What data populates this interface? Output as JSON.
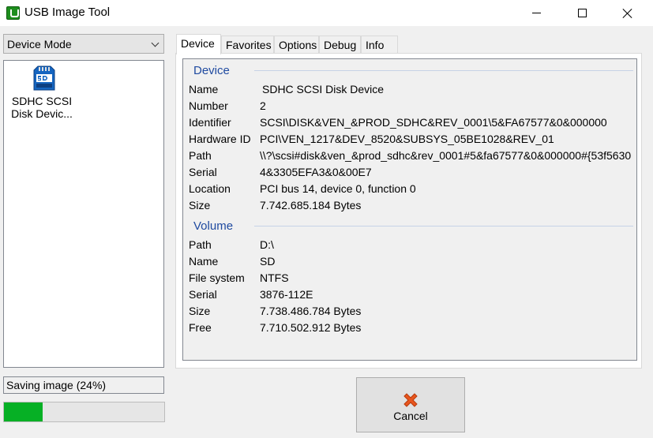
{
  "window": {
    "title": "USB Image Tool"
  },
  "sidebar": {
    "mode_selected": "Device Mode",
    "devices": [
      {
        "label_line1": "SDHC SCSI",
        "label_line2": "Disk Devic..."
      }
    ],
    "status_text": "Saving image (24%)",
    "progress_percent": 24
  },
  "tabs": [
    {
      "label": "Device",
      "active": true
    },
    {
      "label": "Favorites",
      "active": false
    },
    {
      "label": "Options",
      "active": false
    },
    {
      "label": "Debug",
      "active": false
    },
    {
      "label": "Info",
      "active": false
    }
  ],
  "device_section": {
    "title": "Device",
    "rows": [
      {
        "key": "Name",
        "value": "SDHC SCSI Disk Device"
      },
      {
        "key": "Number",
        "value": "2"
      },
      {
        "key": "Identifier",
        "value": "SCSI\\DISK&VEN_&PROD_SDHC&REV_0001\\5&FA67577&0&000000"
      },
      {
        "key": "Hardware ID",
        "value": "PCI\\VEN_1217&DEV_8520&SUBSYS_05BE1028&REV_01"
      },
      {
        "key": "Path",
        "value": "\\\\?\\scsi#disk&ven_&prod_sdhc&rev_0001#5&fa67577&0&000000#{53f5630"
      },
      {
        "key": "Serial",
        "value": "4&3305EFA3&0&00E7"
      },
      {
        "key": "Location",
        "value": "PCI bus 14, device 0, function 0"
      },
      {
        "key": "Size",
        "value": "7.742.685.184 Bytes"
      }
    ]
  },
  "volume_section": {
    "title": "Volume",
    "rows": [
      {
        "key": "Path",
        "value": "D:\\"
      },
      {
        "key": "Name",
        "value": "SD"
      },
      {
        "key": "File system",
        "value": "NTFS"
      },
      {
        "key": "Serial",
        "value": "3876-112E"
      },
      {
        "key": "Size",
        "value": "7.738.486.784 Bytes"
      },
      {
        "key": "Free",
        "value": "7.710.502.912 Bytes"
      }
    ]
  },
  "actions": {
    "cancel_label": "Cancel"
  },
  "colors": {
    "progress": "#06b025",
    "section_title": "#1f4aa0",
    "cancel_icon": "#e8561e"
  },
  "icons": {
    "app": "usb-image-tool-icon",
    "device": "sd-card-icon",
    "cancel": "cancel-x-icon"
  }
}
